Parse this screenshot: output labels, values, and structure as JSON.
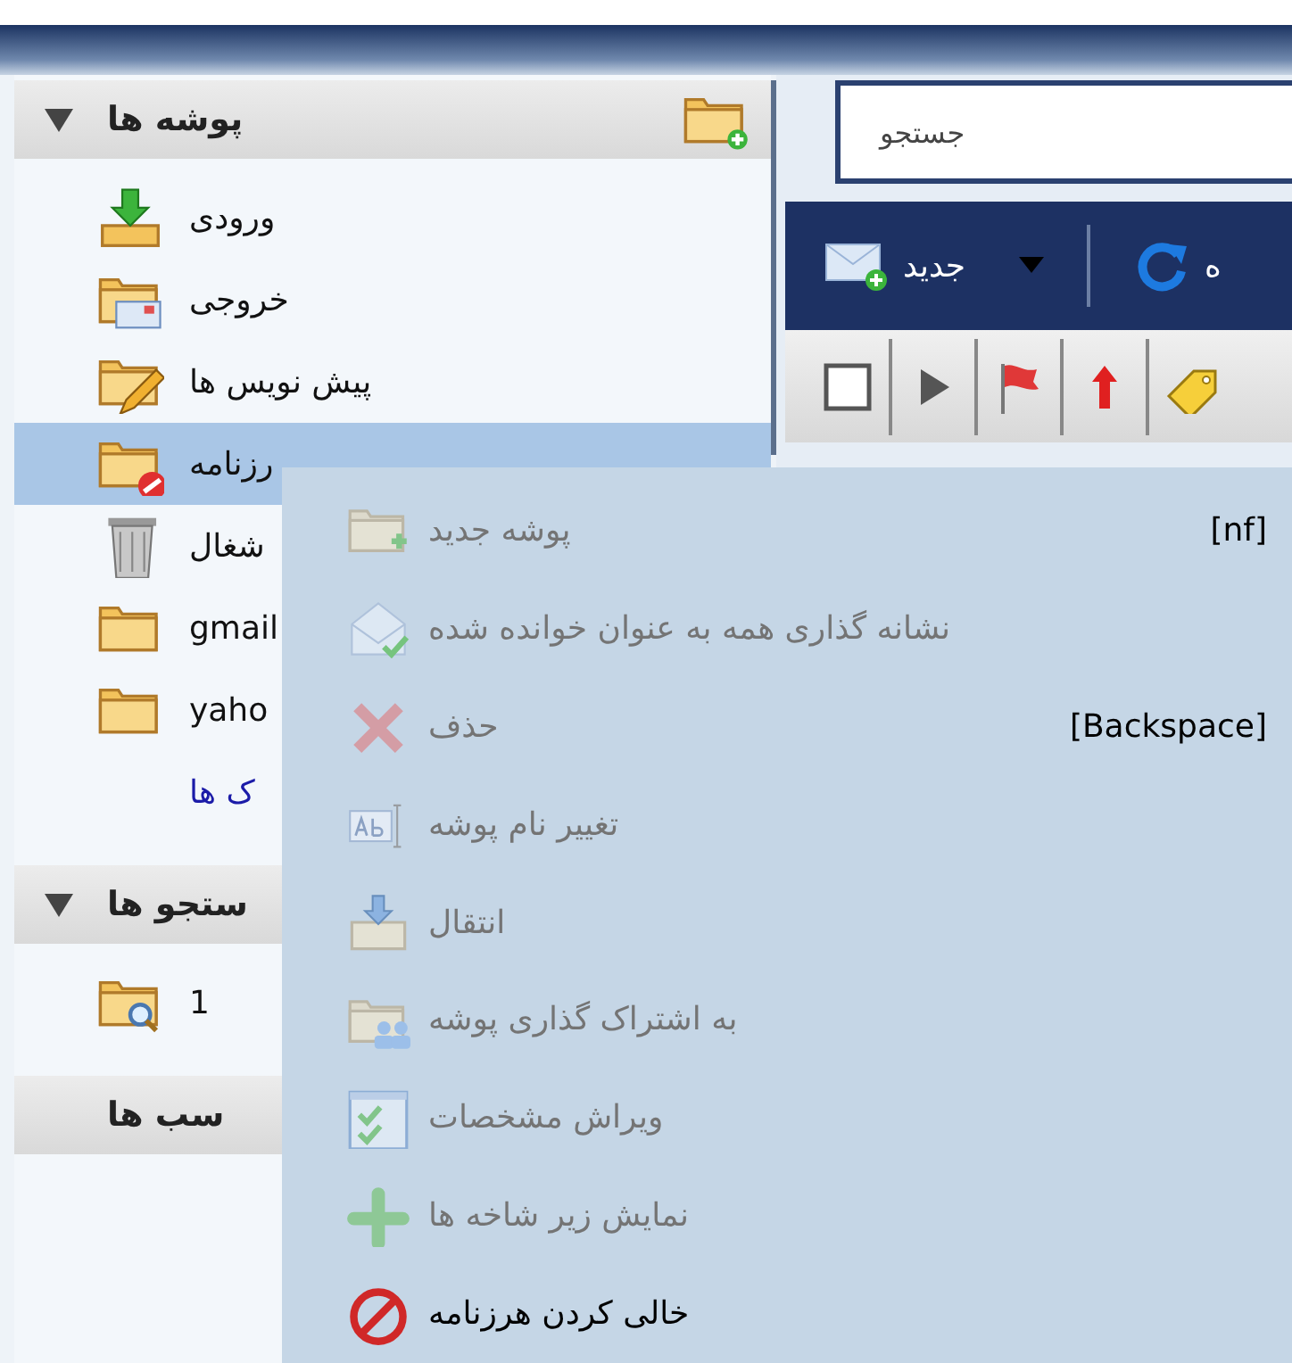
{
  "sidebar": {
    "sections": [
      {
        "title": "پوشه ها",
        "expanded": true,
        "items": [
          {
            "label": "ورودی",
            "kind": "inbox",
            "selected": false
          },
          {
            "label": "خروجی",
            "kind": "sent",
            "selected": false
          },
          {
            "label": "پیش نویس ها",
            "kind": "drafts",
            "selected": false
          },
          {
            "label": "رزنامه",
            "kind": "junk",
            "selected": true
          },
          {
            "label": "شغال",
            "kind": "trash",
            "selected": false
          },
          {
            "label": "gmail",
            "kind": "folder",
            "selected": false
          },
          {
            "label": "yaho",
            "kind": "folder",
            "selected": false
          },
          {
            "label": "ک ها",
            "kind": "link",
            "selected": false
          }
        ]
      },
      {
        "title": "ستجو ها",
        "expanded": true,
        "items": [
          {
            "label": "1",
            "kind": "search",
            "selected": false
          }
        ]
      },
      {
        "title": "سب ها",
        "expanded": false
      }
    ]
  },
  "search": {
    "placeholder": "جستجو"
  },
  "toolbar": {
    "new_button": "جدید",
    "refresh_label": "ه"
  },
  "context_menu": {
    "items": [
      {
        "label": "پوشه جدید",
        "kind": "new_folder",
        "disabled": true,
        "shortcut": "[nf]"
      },
      {
        "label": "نشانه گذاری همه به عنوان خوانده شده",
        "kind": "mark_read",
        "disabled": true
      },
      {
        "label": "حذف",
        "kind": "delete",
        "disabled": true,
        "shortcut": "[Backspace]"
      },
      {
        "label": "تغییر نام پوشه",
        "kind": "rename",
        "disabled": true
      },
      {
        "label": "انتقال",
        "kind": "move",
        "disabled": true
      },
      {
        "label": "به اشتراک گذاری پوشه",
        "kind": "share",
        "disabled": true
      },
      {
        "label": "ویراش مشخصات",
        "kind": "properties",
        "disabled": true
      },
      {
        "label": "نمایش زیر شاخه ها",
        "kind": "expand",
        "disabled": true
      },
      {
        "label": "خالی کردن هرزنامه",
        "kind": "empty",
        "disabled": false
      }
    ]
  }
}
